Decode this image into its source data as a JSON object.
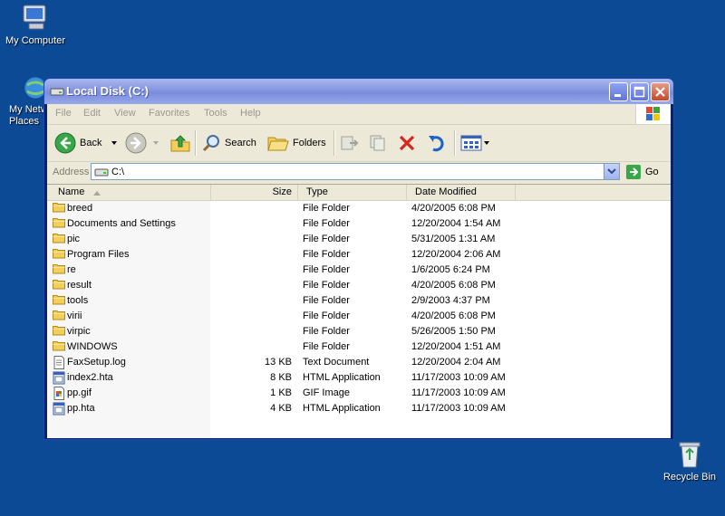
{
  "desktop": {
    "icons": [
      {
        "label": "My Computer"
      },
      {
        "label": "My Network Places"
      },
      {
        "label": "Recycle Bin"
      }
    ]
  },
  "window": {
    "title": "Local Disk (C:)",
    "menu": [
      "File",
      "Edit",
      "View",
      "Favorites",
      "Tools",
      "Help"
    ],
    "toolbar": {
      "back": "Back",
      "search": "Search",
      "folders": "Folders"
    },
    "address": {
      "label": "Address",
      "value": "C:\\",
      "go": "Go"
    },
    "columns": {
      "name": "Name",
      "size": "Size",
      "type": "Type",
      "date": "Date Modified"
    },
    "files": [
      {
        "name": "breed",
        "size": "",
        "type": "File Folder",
        "date": "4/20/2005 6:08 PM",
        "icon": "folder-icon"
      },
      {
        "name": "Documents and Settings",
        "size": "",
        "type": "File Folder",
        "date": "12/20/2004 1:54 AM",
        "icon": "folder-icon"
      },
      {
        "name": "pic",
        "size": "",
        "type": "File Folder",
        "date": "5/31/2005 1:31 AM",
        "icon": "folder-icon"
      },
      {
        "name": "Program Files",
        "size": "",
        "type": "File Folder",
        "date": "12/20/2004 2:06 AM",
        "icon": "folder-icon"
      },
      {
        "name": "re",
        "size": "",
        "type": "File Folder",
        "date": "1/6/2005 6:24 PM",
        "icon": "folder-icon"
      },
      {
        "name": "result",
        "size": "",
        "type": "File Folder",
        "date": "4/20/2005 6:08 PM",
        "icon": "folder-icon"
      },
      {
        "name": "tools",
        "size": "",
        "type": "File Folder",
        "date": "2/9/2003 4:37 PM",
        "icon": "folder-icon"
      },
      {
        "name": "virii",
        "size": "",
        "type": "File Folder",
        "date": "4/20/2005 6:08 PM",
        "icon": "folder-icon"
      },
      {
        "name": "virpic",
        "size": "",
        "type": "File Folder",
        "date": "5/26/2005 1:50 PM",
        "icon": "folder-icon"
      },
      {
        "name": "WINDOWS",
        "size": "",
        "type": "File Folder",
        "date": "12/20/2004 1:51 AM",
        "icon": "folder-icon"
      },
      {
        "name": "FaxSetup.log",
        "size": "13 KB",
        "type": "Text Document",
        "date": "12/20/2004 2:04 AM",
        "icon": "text-file-icon"
      },
      {
        "name": "index2.hta",
        "size": "8 KB",
        "type": "HTML Application",
        "date": "11/17/2003 10:09 AM",
        "icon": "hta-file-icon"
      },
      {
        "name": "pp.gif",
        "size": "1 KB",
        "type": "GIF Image",
        "date": "11/17/2003 10:09 AM",
        "icon": "image-file-icon"
      },
      {
        "name": "pp.hta",
        "size": "4 KB",
        "type": "HTML Application",
        "date": "11/17/2003 10:09 AM",
        "icon": "hta-file-icon"
      }
    ]
  }
}
